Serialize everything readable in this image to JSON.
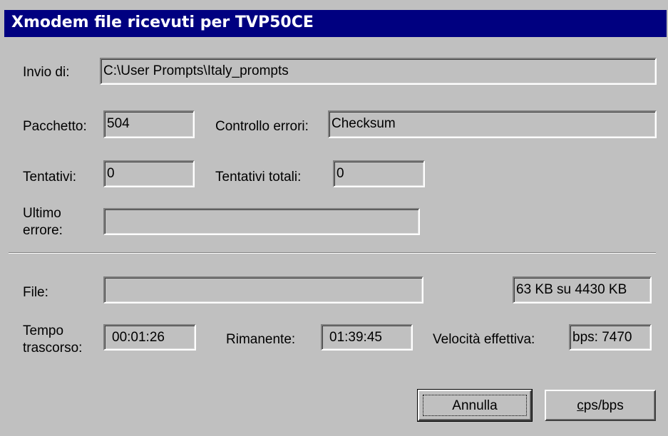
{
  "dialog": {
    "title": "Xmodem file ricevuti per TVP50CE",
    "invio": {
      "label": "Invio di:",
      "value": "C:\\User Prompts\\Italy_prompts"
    },
    "pacchetto": {
      "label": "Pacchetto:",
      "value": "504"
    },
    "controllo": {
      "label": "Controllo errori:",
      "value": "Checksum"
    },
    "tentativi": {
      "label": "Tentativi:",
      "value": "0"
    },
    "tentativi_totali": {
      "label": "Tentativi totali:",
      "value": "0"
    },
    "ultimo_errore": {
      "label_line1": "Ultimo",
      "label_line2": "errore:",
      "value": ""
    },
    "file": {
      "label": "File:",
      "value": "",
      "size": "63 KB su 4430 KB"
    },
    "tempo": {
      "label_line1": "Tempo",
      "label_line2": "trascorso:",
      "value": "00:01:26"
    },
    "rimanente": {
      "label": "Rimanente:",
      "value": "01:39:45"
    },
    "velocita": {
      "label": "Velocità effettiva:",
      "value": "bps: 7470"
    },
    "buttons": {
      "annulla": "Annulla",
      "cps_first": "c",
      "cps_rest": "ps/bps"
    }
  }
}
